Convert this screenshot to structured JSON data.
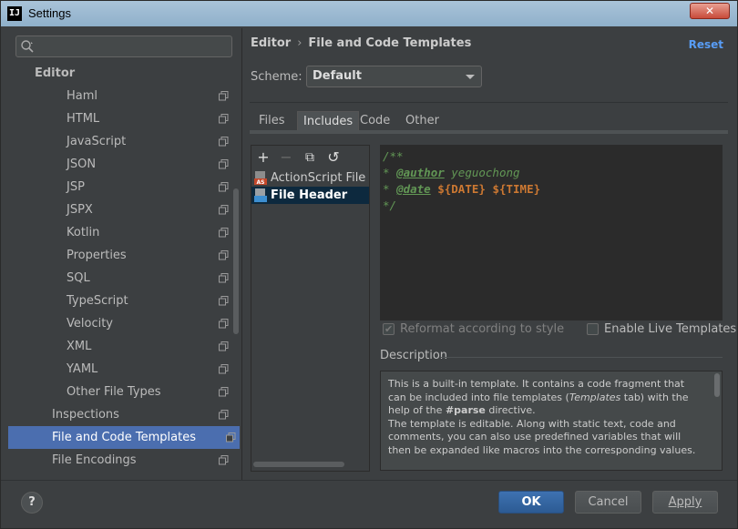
{
  "window": {
    "title": "Settings",
    "app_icon_text": "IJ",
    "close_label": "✕"
  },
  "search": {
    "placeholder": "",
    "value": ""
  },
  "tree": {
    "section": "Editor",
    "items": [
      "Haml",
      "HTML",
      "JavaScript",
      "JSON",
      "JSP",
      "JSPX",
      "Kotlin",
      "Properties",
      "SQL",
      "TypeScript",
      "Velocity",
      "XML",
      "YAML",
      "Other File Types"
    ],
    "after": [
      "Inspections",
      "File and Code Templates",
      "File Encodings"
    ],
    "selected": "File and Code Templates"
  },
  "breadcrumb": {
    "parent": "Editor",
    "separator": "›",
    "current": "File and Code Templates"
  },
  "reset_label": "Reset",
  "scheme": {
    "label": "Scheme:",
    "value": "Default"
  },
  "tabs": [
    "Files",
    "Includes",
    "Code",
    "Other"
  ],
  "active_tab": "Includes",
  "list_toolbar": {
    "add": "+",
    "remove": "−",
    "copy": "⧉",
    "revert": "↺"
  },
  "templates": [
    {
      "name": "ActionScript File Header",
      "icon_text": "AS"
    },
    {
      "name": "File Header",
      "icon_text": ""
    }
  ],
  "selected_template": "File Header",
  "editor": {
    "line1": "/**",
    "line2_prefix": "* ",
    "line2_tag": "@author",
    "line2_value": " yeguochong",
    "line3_prefix": "* ",
    "line3_tag": "@date",
    "line3_var1": "${DATE}",
    "line3_var2": "${TIME}",
    "line4": "*/"
  },
  "options": {
    "reformat": {
      "label": "Reformat according to style",
      "checked": true,
      "enabled": false
    },
    "live_templates": {
      "label": "Enable Live Templates",
      "checked": false,
      "enabled": true
    }
  },
  "description": {
    "title": "Description",
    "p1_a": "This is a built-in template. It contains a code fragment that can be included into file templates (",
    "p1_em": "Templates",
    "p1_b": " tab) with the help of the ",
    "p1_strong": "#parse",
    "p1_c": " directive.",
    "p2": "The template is editable. Along with static text, code and comments, you can also use predefined variables that will then be expanded like macros into the corresponding values."
  },
  "buttons": {
    "help": "?",
    "ok": "OK",
    "cancel": "Cancel",
    "apply": "Apply"
  },
  "colors": {
    "selection": "#4b6eaf",
    "ok": "#365f9c",
    "link": "#589df6"
  }
}
